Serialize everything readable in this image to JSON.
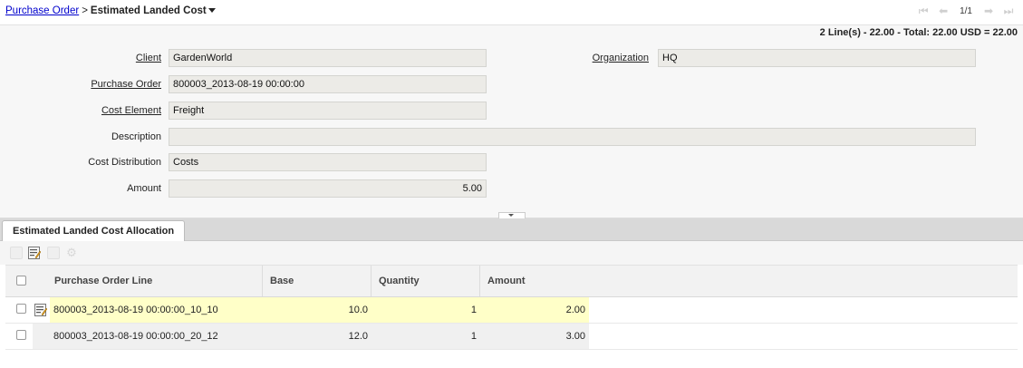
{
  "breadcrumb": {
    "parent": "Purchase Order",
    "separator": ">",
    "current": "Estimated Landed Cost"
  },
  "nav": {
    "count": "1/1"
  },
  "summary": "2 Line(s) - 22.00 - Total: 22.00 USD = 22.00",
  "form": {
    "client_label": "Client",
    "client_value": "GardenWorld",
    "org_label": "Organization",
    "org_value": "HQ",
    "po_label": "Purchase Order",
    "po_value": "800003_2013-08-19 00:00:00",
    "cost_element_label": "Cost Element",
    "cost_element_value": "Freight",
    "description_label": "Description",
    "description_value": "",
    "cost_dist_label": "Cost Distribution",
    "cost_dist_value": "Costs",
    "amount_label": "Amount",
    "amount_value": "5.00"
  },
  "tab": {
    "label": "Estimated Landed Cost Allocation"
  },
  "grid": {
    "columns": [
      "Purchase Order Line",
      "Base",
      "Quantity",
      "Amount"
    ],
    "rows": [
      {
        "po_line": "800003_2013-08-19 00:00:00_10_10",
        "base": "10.0",
        "quantity": "1",
        "amount": "2.00"
      },
      {
        "po_line": "800003_2013-08-19 00:00:00_20_12",
        "base": "12.0",
        "quantity": "1",
        "amount": "3.00"
      }
    ]
  },
  "colors": {
    "selected_row": "#ffffc8",
    "field_bg": "#ecebe7",
    "link": "#0000cc"
  }
}
